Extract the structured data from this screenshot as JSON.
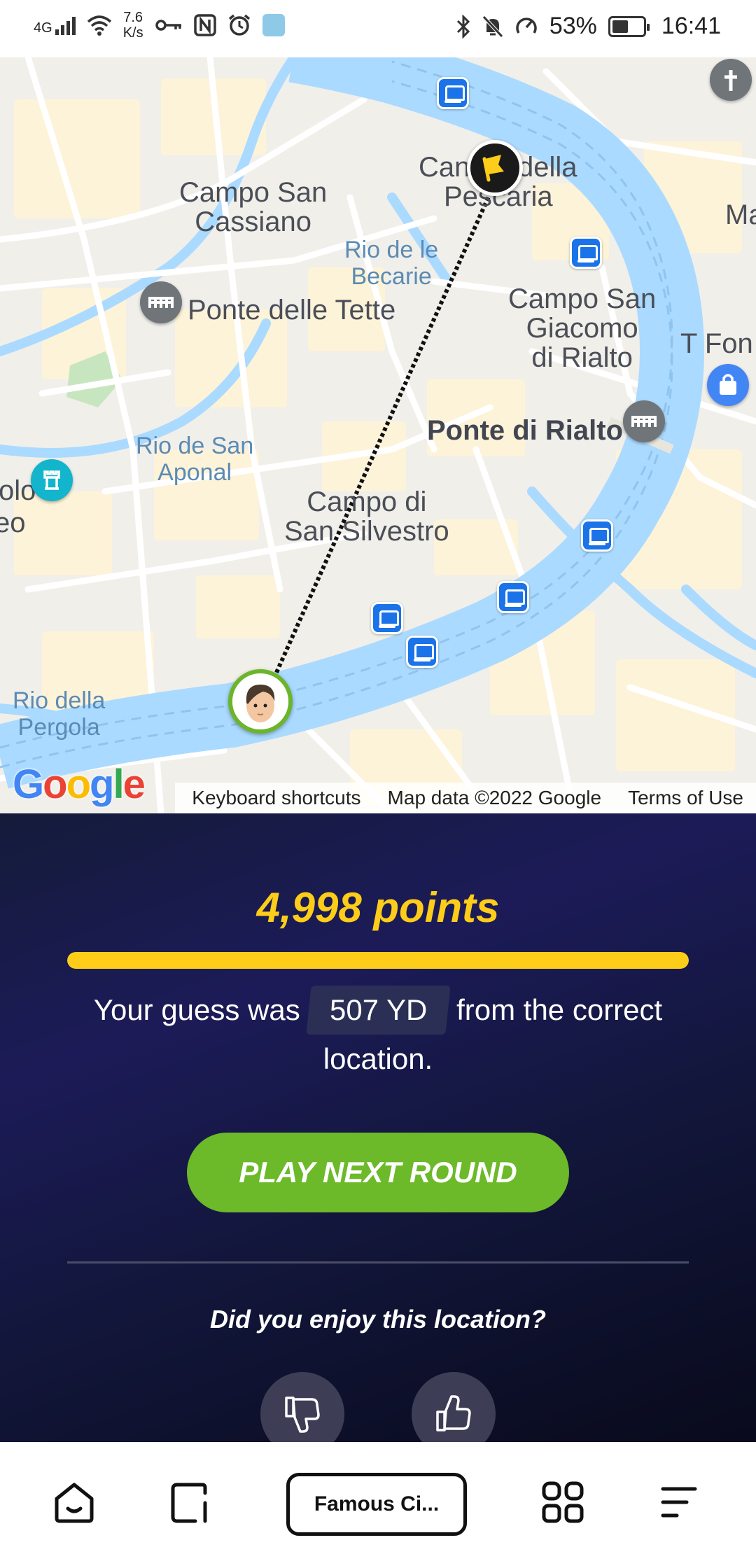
{
  "status_bar": {
    "network": "4G",
    "speed_value": "7.6",
    "speed_unit": "K/s",
    "battery": "53%",
    "time": "16:41"
  },
  "map": {
    "labels": {
      "campo_san_cassiano": "Campo San\nCassiano",
      "rio_becarie": "Rio de le\nBecarie",
      "ponte_tette": "Ponte delle Tette",
      "campo_san_giacomo": "Campo San\nGiacomo\ndi Rialto",
      "t_fon": "T Fon",
      "ponte_rialto": "Ponte di Rialto",
      "rio_san_aponal": "Rio de San\nAponal",
      "campo_san_silvestro": "Campo di\nSan Silvestro",
      "rio_pergola": "Rio della\nPergola",
      "ma": "Ma",
      "olo": "olo",
      "eo": "eo",
      "campo_pescaria_a": "Can",
      "campo_pescaria_b": "della",
      "campo_pescaria_c": "Pescaria"
    },
    "google_logo": "Google",
    "attribution": {
      "keyboard": "Keyboard shortcuts",
      "map_data": "Map data ©2022 Google",
      "terms": "Terms of Use"
    },
    "colors": {
      "water": "#aadaff",
      "land": "#f1efe9",
      "road": "#ffffff",
      "block": "#fdf3d8"
    }
  },
  "result": {
    "points": "4,998 points",
    "progress_fraction": 0.9996,
    "guess_prefix": "Your guess was",
    "distance": "507 YD",
    "guess_suffix": "from the correct location.",
    "play_button": "PLAY NEXT ROUND",
    "enjoy_question": "Did you enjoy this location?",
    "colors": {
      "accent": "#fecd19",
      "button": "#6cb92a"
    }
  },
  "bottom_nav": {
    "tab_label": "Famous Ci..."
  }
}
